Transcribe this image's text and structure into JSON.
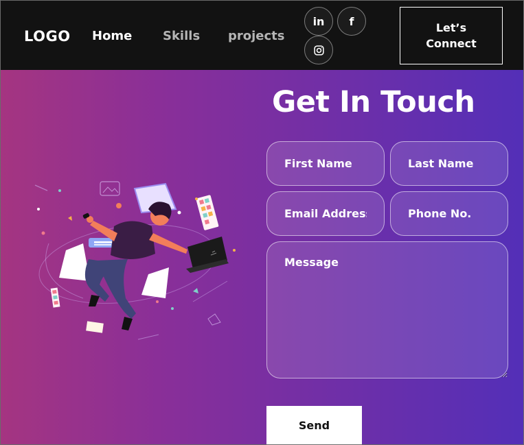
{
  "nav": {
    "logo": "LOGO",
    "links": [
      "Home",
      "Skills",
      "projects"
    ],
    "socials": [
      {
        "name": "linkedin-icon",
        "glyph": "in"
      },
      {
        "name": "facebook-icon",
        "glyph": "f"
      },
      {
        "name": "instagram-icon"
      }
    ],
    "connect_line1": "Let’s",
    "connect_line2": "Connect"
  },
  "contact": {
    "title": "Get In Touch",
    "fields": {
      "first_name": "First Name",
      "last_name": "Last Name",
      "email": "Email Address",
      "phone": "Phone No.",
      "message": "Message"
    },
    "send_label": "Send"
  },
  "colors": {
    "nav_bg": "#121212",
    "gradient_start": "#aa367c",
    "gradient_end": "#4a2fbd",
    "button_bg": "#ffffff"
  }
}
